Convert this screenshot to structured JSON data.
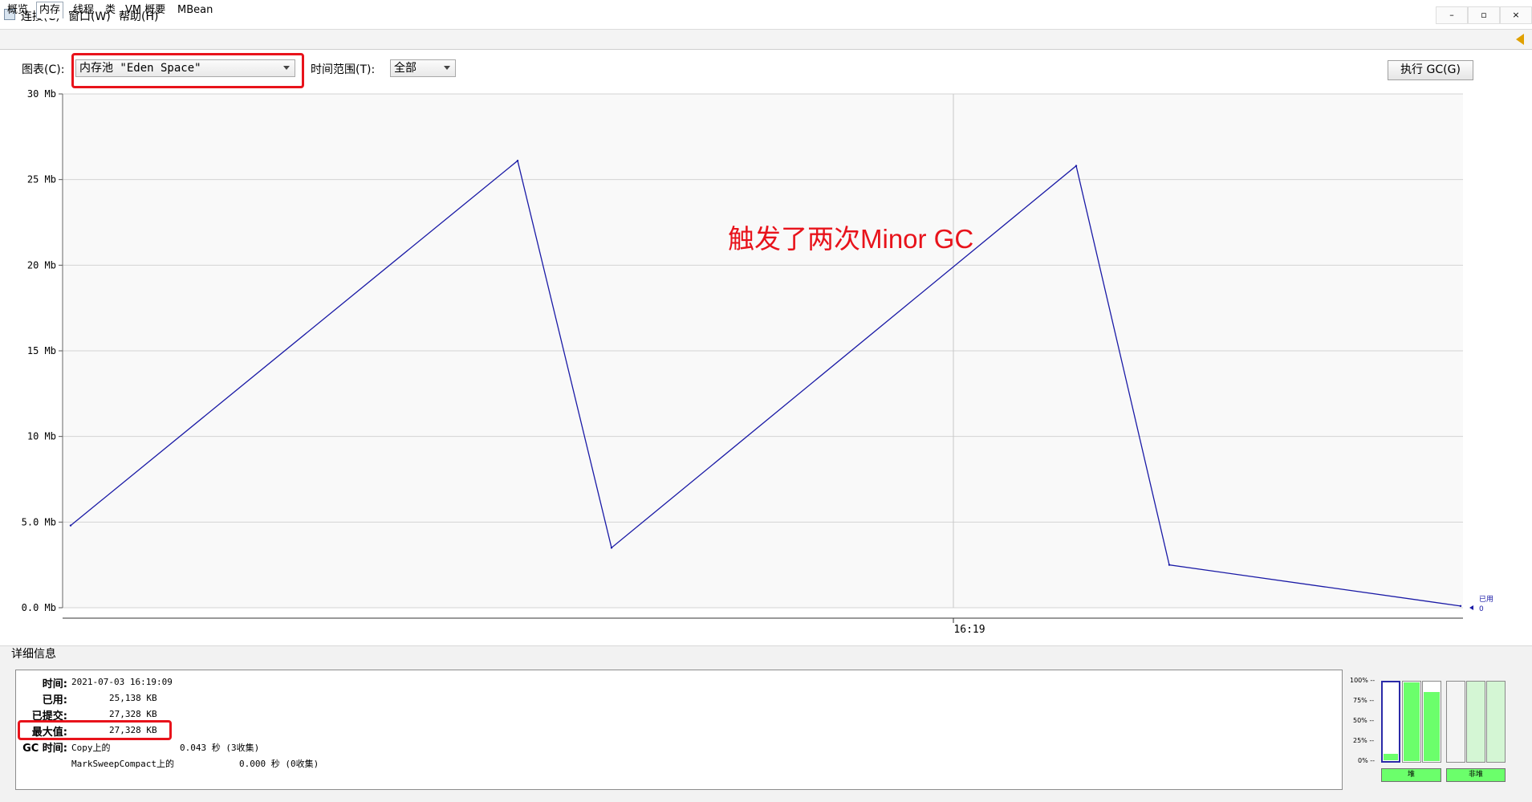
{
  "menubar": {
    "items": [
      "连接(C)",
      "窗口(W)",
      "帮助(H)"
    ],
    "window_controls": [
      "–",
      "▫",
      "×"
    ]
  },
  "tabs": [
    "概览",
    "内存",
    "线程",
    "类",
    "VM 概要",
    "MBean"
  ],
  "active_tab": "内存",
  "toolbar": {
    "chart_label": "图表(C):",
    "chart_value": "内存池 \"Eden Space\"",
    "time_range_label": "时间范围(T):",
    "time_range_value": "全部",
    "gc_button": "执行 GC(G)"
  },
  "annotation": "触发了两次Minor GC",
  "colors": {
    "accent_red": "#e8131b",
    "series": "#1a1aa6",
    "gauge_green": "#6bff6b"
  },
  "chart_data": {
    "type": "line",
    "y_tick_labels": [
      "0.0 Mb",
      "5.0 Mb",
      "10 Mb",
      "15 Mb",
      "20 Mb",
      "25 Mb",
      "30 Mb"
    ],
    "ylim": [
      0,
      30
    ],
    "x_tick_labels": [
      "16:19"
    ],
    "series": [
      {
        "name": "已用",
        "current_value": "0",
        "values": [
          4.8,
          26.1,
          3.5,
          25.8,
          2.5,
          0.1
        ]
      }
    ]
  },
  "details": {
    "title": "详细信息",
    "rows": [
      {
        "key": "时间:",
        "value": "2021-07-03 16:19:09"
      },
      {
        "key": "已用:",
        "value": "25,138 KB"
      },
      {
        "key": "已提交:",
        "value": "27,328 KB"
      },
      {
        "key": "最大值:",
        "value": "27,328 KB"
      }
    ],
    "gc_time": {
      "key": "GC 时间:",
      "entries": [
        {
          "name": "Copy上的",
          "value": "0.043 秒 (3收集)"
        },
        {
          "name": "MarkSweepCompact上的",
          "value": "0.000 秒 (0收集)"
        }
      ]
    }
  },
  "gauges": {
    "pct_labels": [
      "100% --",
      "75% --",
      "50% --",
      "25% --",
      "0% --"
    ],
    "heap_label": "堆",
    "nonheap_label": "非堆",
    "heap_levels": [
      0.08,
      1.0,
      0.88
    ],
    "nonheap_levels": [
      0,
      0,
      0
    ]
  }
}
